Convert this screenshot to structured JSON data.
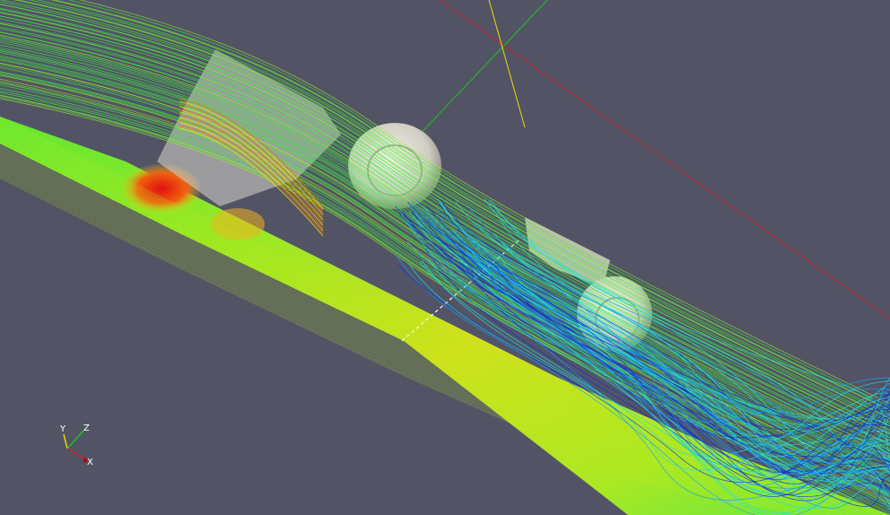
{
  "viewport": {
    "background": "#525466"
  },
  "axes_triad": {
    "x_label": "X",
    "y_label": "Y",
    "z_label": "Z",
    "x_color": "#d0202a",
    "y_color": "#e8e000",
    "z_color": "#20c020"
  },
  "scene": {
    "model": "car-body-wireframe-with-wheels",
    "colormap": [
      "#1030e0",
      "#10a0ff",
      "#20e0e0",
      "#40f040",
      "#a0f020",
      "#f0e010",
      "#f07010",
      "#e01010"
    ],
    "surface_color": "#d8d6cc",
    "axis_lines": {
      "x_color": "#c0202a",
      "y_color": "#e8e000",
      "z_color": "#20c020"
    }
  }
}
